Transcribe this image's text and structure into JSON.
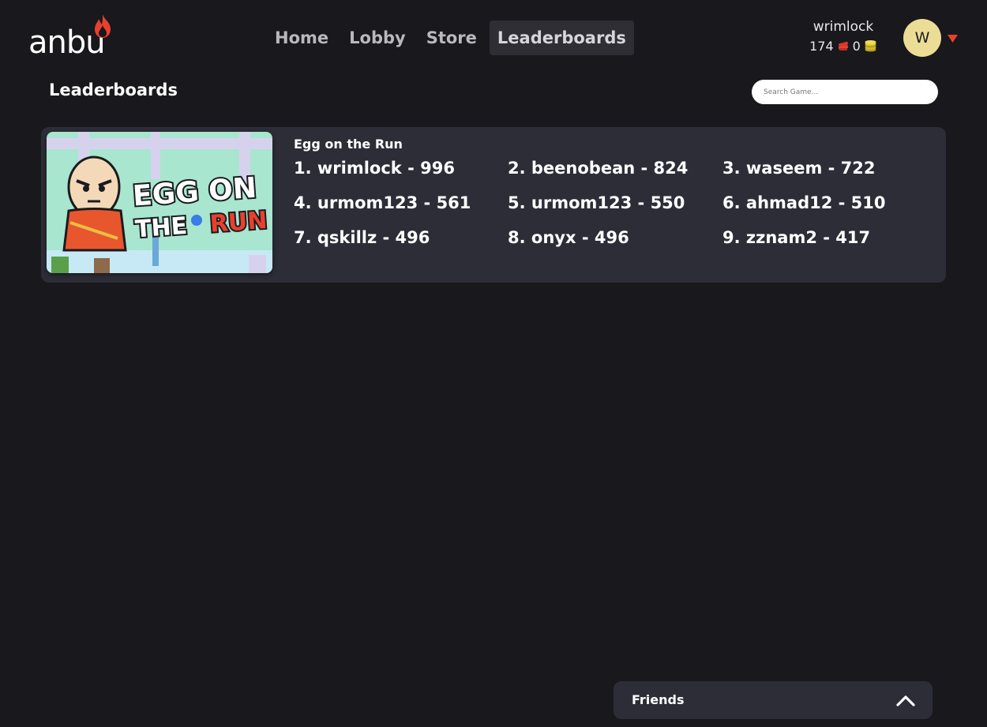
{
  "header": {
    "logo_text": "anbu",
    "nav": [
      {
        "label": "Home",
        "active": false
      },
      {
        "label": "Lobby",
        "active": false
      },
      {
        "label": "Store",
        "active": false
      },
      {
        "label": "Leaderboards",
        "active": true
      }
    ],
    "user": {
      "username": "wrimlock",
      "tickets": "174",
      "coins": "0",
      "avatar_initial": "W"
    }
  },
  "page": {
    "title": "Leaderboards",
    "search_placeholder": "Search Game..."
  },
  "leaderboards": [
    {
      "game_title": "Egg on the Run",
      "thumbnail_text": [
        "EGG ON",
        "THE",
        "RUN"
      ],
      "entries": [
        {
          "text": "1. wrimlock - 996"
        },
        {
          "text": "2. beenobean - 824"
        },
        {
          "text": "3. waseem - 722"
        },
        {
          "text": "4. urmom123 - 561"
        },
        {
          "text": "5. urmom123 - 550"
        },
        {
          "text": "6. ahmad12 - 510"
        },
        {
          "text": "7. qskillz - 496"
        },
        {
          "text": "8. onyx - 496"
        },
        {
          "text": "9. zznam2 - 417"
        }
      ]
    }
  ],
  "friends": {
    "label": "Friends"
  },
  "colors": {
    "background": "#18181d",
    "card": "#2d2d38",
    "nav_inactive": "#b9b9bd",
    "nav_active_bg": "#2e2e34",
    "avatar_bg": "#ecdd96",
    "accent_red": "#e8402e",
    "thumb_bg": "#a8e6cf"
  },
  "icons": {
    "logo": "flame-icon",
    "tickets": "ticket-icon",
    "coins": "coin-stack-icon",
    "dropdown": "caret-down-icon",
    "friends_toggle": "chevron-up-icon"
  }
}
